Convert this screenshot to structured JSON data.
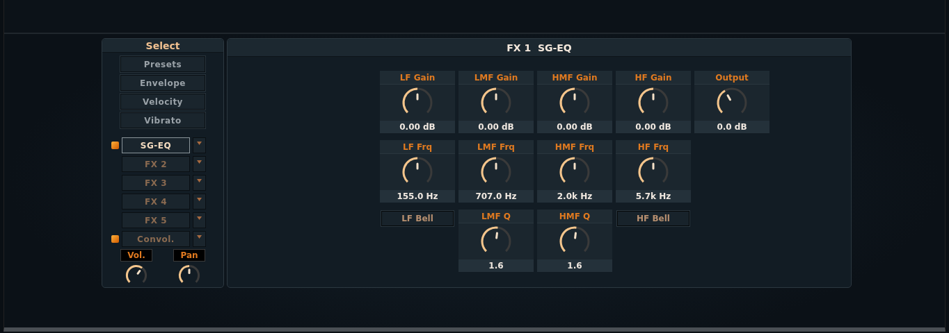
{
  "select_panel": {
    "title": "Select",
    "nav_buttons": [
      "Presets",
      "Envelope",
      "Velocity",
      "Vibrato"
    ],
    "fx_slots": [
      {
        "label": "SG-EQ",
        "on": true,
        "selected": true
      },
      {
        "label": "FX 2",
        "on": false,
        "selected": false
      },
      {
        "label": "FX 3",
        "on": false,
        "selected": false
      },
      {
        "label": "FX 4",
        "on": false,
        "selected": false
      },
      {
        "label": "FX 5",
        "on": false,
        "selected": false
      },
      {
        "label": "Convol.",
        "on": true,
        "selected": false
      }
    ],
    "mix_knobs": [
      {
        "label": "Vol.",
        "level": 0.8
      },
      {
        "label": "Pan",
        "level": 0.5
      }
    ]
  },
  "eq_panel": {
    "title": "FX 1  SG-EQ",
    "cells": [
      {
        "kind": "knob",
        "label": "LF Gain",
        "reading": "0.00 dB",
        "level": 0.5
      },
      {
        "kind": "knob",
        "label": "LMF Gain",
        "reading": "0.00 dB",
        "level": 0.5
      },
      {
        "kind": "knob",
        "label": "HMF Gain",
        "reading": "0.00 dB",
        "level": 0.5
      },
      {
        "kind": "knob",
        "label": "HF Gain",
        "reading": "0.00 dB",
        "level": 0.5
      },
      {
        "kind": "knob",
        "label": "Output",
        "reading": "0.0 dB",
        "level": 0.25
      },
      {
        "kind": "knob",
        "label": "LF Frq",
        "reading": "155.0 Hz",
        "level": 0.5
      },
      {
        "kind": "knob",
        "label": "LMF Frq",
        "reading": "707.0 Hz",
        "level": 0.5
      },
      {
        "kind": "knob",
        "label": "HMF Frq",
        "reading": "2.0k Hz",
        "level": 0.5
      },
      {
        "kind": "knob",
        "label": "HF Frq",
        "reading": "5.7k Hz",
        "level": 0.5
      },
      {
        "kind": "empty"
      },
      {
        "kind": "toggle",
        "label": "LF Bell"
      },
      {
        "kind": "knob",
        "label": "LMF Q",
        "reading": "1.6",
        "level": 0.56
      },
      {
        "kind": "knob",
        "label": "HMF Q",
        "reading": "1.6",
        "level": 0.56
      },
      {
        "kind": "toggle",
        "label": "HF Bell"
      },
      {
        "kind": "empty"
      }
    ]
  }
}
